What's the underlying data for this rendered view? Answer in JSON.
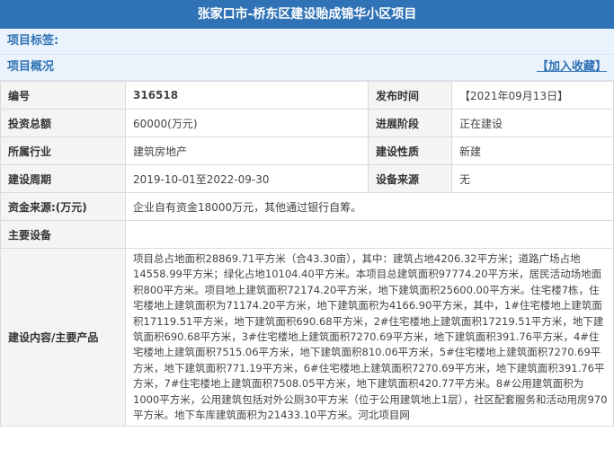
{
  "page_title": "张家口市-桥东区建设贻成锦华小区项目",
  "tags_label": "项目标签:",
  "overview_label": "项目概况",
  "favorite_link": "【加入收藏】",
  "rows": {
    "code": {
      "label": "编号",
      "value": "316518",
      "label2": "发布时间",
      "value2": "【2021年09月13日】"
    },
    "investment": {
      "label": "投资总额",
      "value": "60000(万元)",
      "label2": "进展阶段",
      "value2": "正在建设"
    },
    "industry": {
      "label": "所属行业",
      "value": "建筑房地产",
      "label2": "建设性质",
      "value2": "新建"
    },
    "period": {
      "label": "建设周期",
      "value": "2019-10-01至2022-09-30",
      "label2": "设备来源",
      "value2": "无"
    },
    "funds": {
      "label": "资金来源:(万元)",
      "value": "企业自有资金18000万元，其他通过银行自筹。"
    },
    "equipment": {
      "label": "主要设备",
      "value": ""
    },
    "content": {
      "label": "建设内容/主要产品",
      "value": "项目总占地面积28869.71平方米（合43.30亩），其中：建筑占地4206.32平方米；道路广场占地14558.99平方米；绿化占地10104.40平方米。本项目总建筑面积97774.20平方米，居民活动场地面积800平方米。项目地上建筑面积72174.20平方米，地下建筑面积25600.00平方米。住宅楼7栋，住宅楼地上建筑面积为71174.20平方米，地下建筑面积为4166.90平方米，其中，1#住宅楼地上建筑面积17119.51平方米，地下建筑面积690.68平方米，2#住宅楼地上建筑面积17219.51平方米，地下建筑面积690.68平方米，3#住宅楼地上建筑面积7270.69平方米，地下建筑面积391.76平方米，4#住宅楼地上建筑面积7515.06平方米，地下建筑面积810.06平方米，5#住宅楼地上建筑面积7270.69平方米，地下建筑面积771.19平方米，6#住宅楼地上建筑面积7270.69平方米，地下建筑面积391.76平方米，7#住宅楼地上建筑面积7508.05平方米，地下建筑面积420.77平方米。8#公用建筑面积为1000平方米，公用建筑包括对外公厕30平方米（位于公用建筑地上1层），社区配套服务和活动用房970平方米。地下车库建筑面积为21433.10平方米。河北项目网"
    }
  }
}
